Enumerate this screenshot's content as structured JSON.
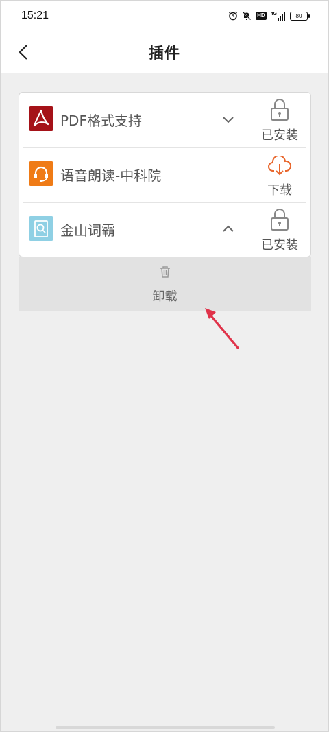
{
  "status_bar": {
    "time": "15:21",
    "hd_label": "HD",
    "network": "4G",
    "battery": "80"
  },
  "header": {
    "title": "插件"
  },
  "plugins": [
    {
      "name": "PDF格式支持",
      "status": "已安装",
      "expanded": false,
      "icon": "pdf-icon",
      "action_icon": "lock-icon"
    },
    {
      "name": "语音朗读-中科院",
      "status": "下载",
      "icon": "headset-icon",
      "action_icon": "cloud-download-icon"
    },
    {
      "name": "金山词霸",
      "status": "已安装",
      "expanded": true,
      "icon": "dictionary-icon",
      "action_icon": "lock-icon"
    }
  ],
  "uninstall": {
    "label": "卸载",
    "icon": "trash-icon"
  },
  "colors": {
    "accent_orange": "#e8662c",
    "pdf_red": "#b3161a",
    "annotation_red": "#e0334a"
  }
}
